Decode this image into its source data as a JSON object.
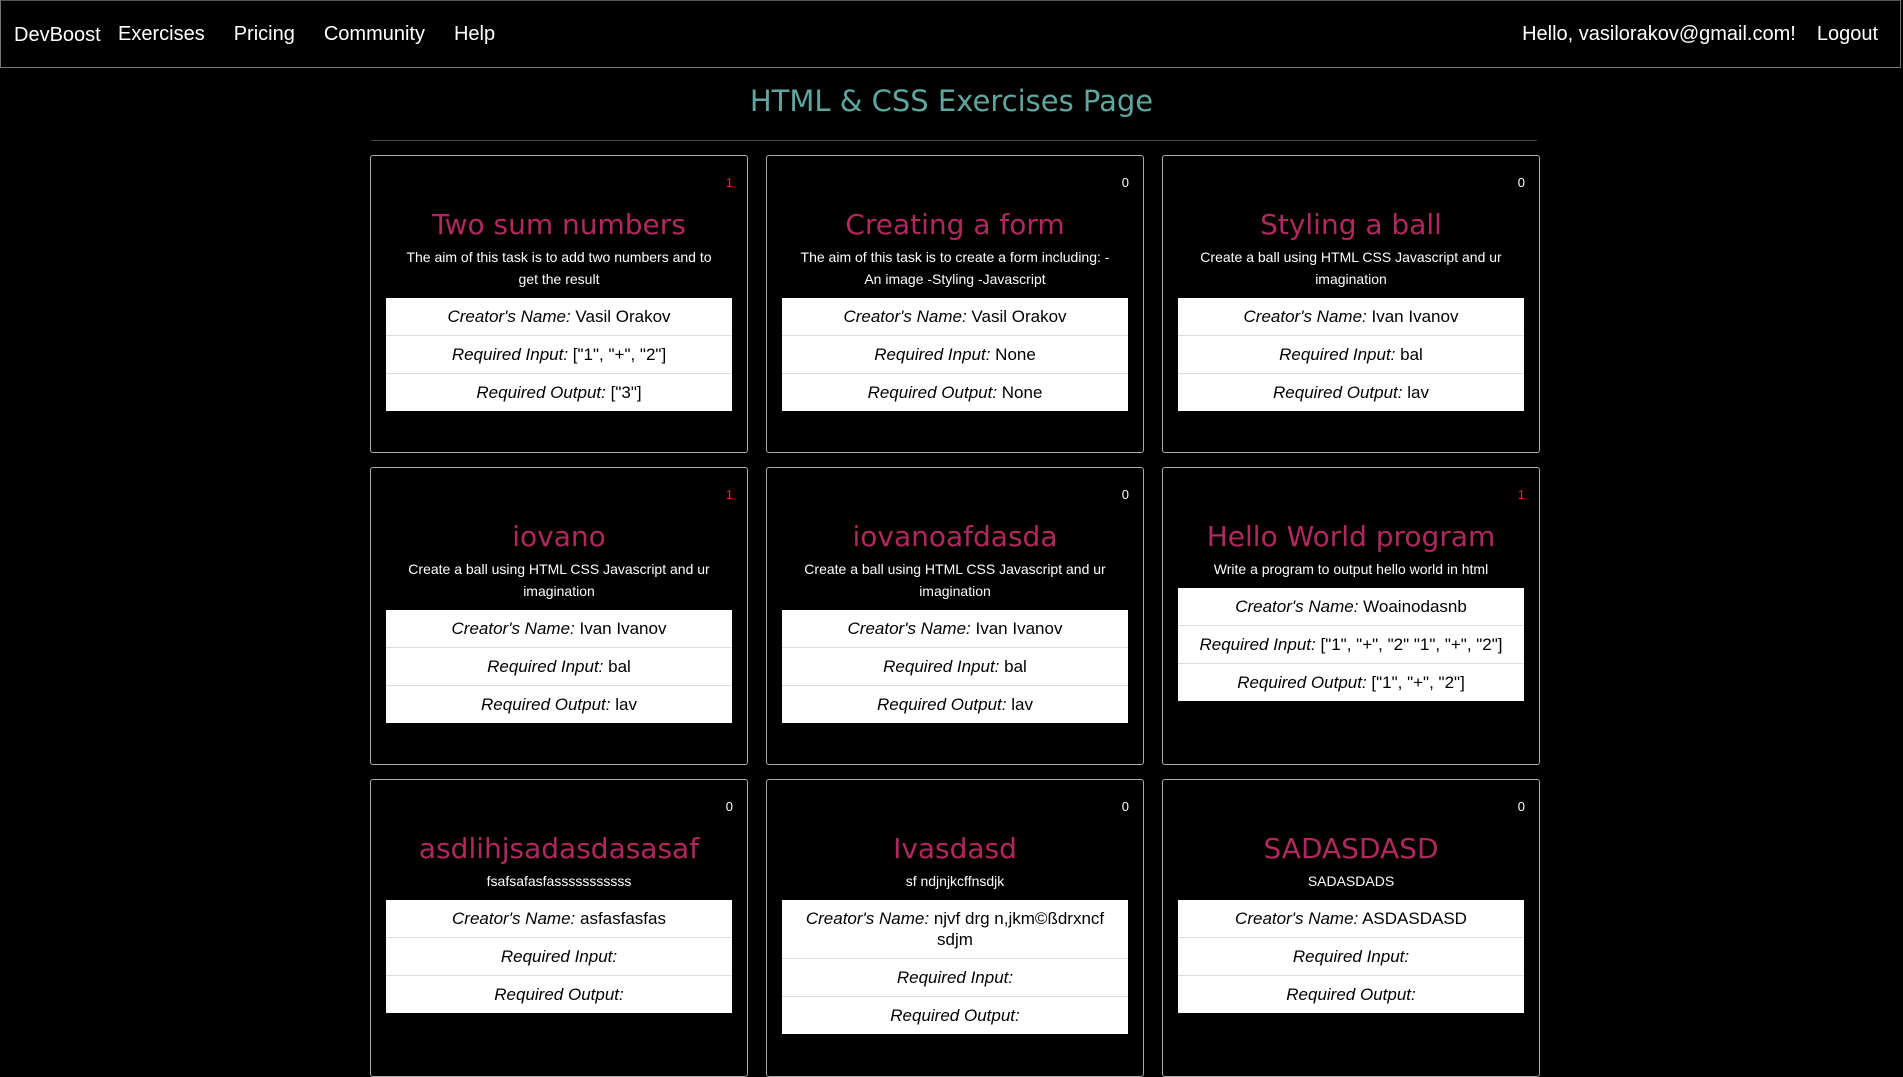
{
  "nav": {
    "brand": "DevBoost",
    "links": [
      "Exercises",
      "Pricing",
      "Community",
      "Help"
    ],
    "greeting": "Hello, vasilorakov@gmail.com!",
    "logout": "Logout"
  },
  "page": {
    "title": "HTML & CSS Exercises Page"
  },
  "labels": {
    "creator": "Creator's Name:",
    "input": "Required Input:",
    "output": "Required Output:"
  },
  "cards": [
    {
      "count": "1",
      "hot": true,
      "title": "Two sum numbers",
      "description": "The aim of this task is to add two numbers and to get the result",
      "creator": "Vasil Orakov",
      "input": "[\"1\", \"+\", \"2\"]",
      "output": "[\"3\"]"
    },
    {
      "count": "0",
      "hot": false,
      "title": "Creating a form",
      "description": "The aim of this task is to create a form including: - An image -Styling -Javascript",
      "creator": "Vasil Orakov",
      "input": "None",
      "output": "None"
    },
    {
      "count": "0",
      "hot": false,
      "title": "Styling a ball",
      "description": "Create a ball using HTML CSS Javascript and ur imagination",
      "creator": "Ivan Ivanov",
      "input": "bal",
      "output": "lav"
    },
    {
      "count": "1",
      "hot": true,
      "title": "iovano",
      "description": "Create a ball using HTML CSS Javascript and ur imagination",
      "creator": "Ivan Ivanov",
      "input": "bal",
      "output": "lav"
    },
    {
      "count": "0",
      "hot": false,
      "title": "iovanoafdasda",
      "description": "Create a ball using HTML CSS Javascript and ur imagination",
      "creator": "Ivan Ivanov",
      "input": "bal",
      "output": "lav"
    },
    {
      "count": "1",
      "hot": true,
      "title": "Hello World program",
      "description": "Write a program to output hello world in html",
      "creator": "Woainodasnb",
      "input": "[\"1\", \"+\", \"2\" \"1\", \"+\", \"2\"]",
      "output": "[\"1\", \"+\", \"2\"]"
    },
    {
      "count": "0",
      "hot": false,
      "title": "asdlihjsadasdasasaf",
      "description": "fsafsafasfasssssssssss",
      "creator": "asfasfasfas",
      "input": "",
      "output": ""
    },
    {
      "count": "0",
      "hot": false,
      "title": "Ivasdasd",
      "description": "sf ndjnjkcffnsdjk",
      "creator": "njvf drg n,jkm©ßdrxncf sdjm",
      "input": "",
      "output": ""
    },
    {
      "count": "0",
      "hot": false,
      "title": "SADASDASD",
      "description": "SADASDADS",
      "creator": "ASDASDASD",
      "input": "",
      "output": ""
    }
  ],
  "colors": {
    "title_accent": "#5fa6a0",
    "card_title": "#b0285e",
    "badge_hot": "#e0203a"
  }
}
